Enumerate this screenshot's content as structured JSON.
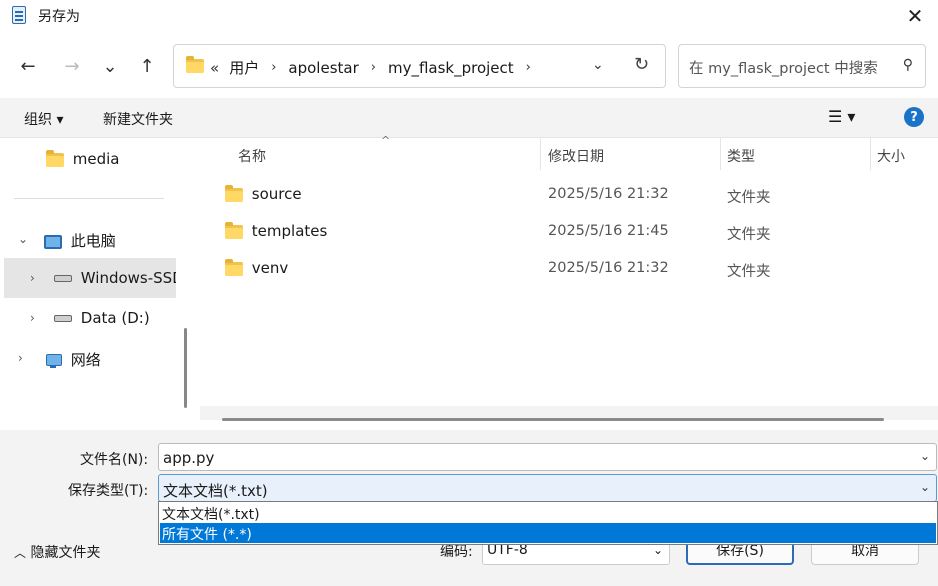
{
  "window": {
    "title": "另存为",
    "close": "✕"
  },
  "nav": {
    "back": "←",
    "forward": "→",
    "recent": "⌄",
    "up": "↑",
    "path": [
      "用户",
      "apolestar",
      "my_flask_project"
    ],
    "overflow": "«",
    "search_placeholder": "在 my_flask_project 中搜索"
  },
  "toolbar": {
    "organize": "组织 ▾",
    "new_folder": "新建文件夹",
    "view": "☰ ▾",
    "help": "?"
  },
  "sidebar": {
    "items": [
      {
        "label": "media"
      },
      {
        "label": "此电脑"
      },
      {
        "label": "Windows-SSD"
      },
      {
        "label": "Data (D:)"
      },
      {
        "label": "网络"
      }
    ]
  },
  "files": {
    "columns": [
      "名称",
      "修改日期",
      "类型",
      "大小"
    ],
    "rows": [
      {
        "name": "source",
        "date": "2025/5/16 21:32",
        "type": "文件夹"
      },
      {
        "name": "templates",
        "date": "2025/5/16 21:45",
        "type": "文件夹"
      },
      {
        "name": "venv",
        "date": "2025/5/16 21:32",
        "type": "文件夹"
      }
    ]
  },
  "save": {
    "filename_label": "文件名(N):",
    "filename_value": "app.py",
    "filetype_label": "保存类型(T):",
    "filetype_value": "文本文档(*.txt)",
    "filetype_options": [
      "文本文档(*.txt)",
      "所有文件  (*.*)"
    ],
    "selected_option": 1,
    "encoding_label": "编码:",
    "encoding_value": "UTF-8",
    "save_button": "保存(S)",
    "cancel_button": "取消",
    "hide_folders": "隐藏文件夹"
  },
  "colors": {
    "accent": "#0078d7",
    "folder": "#ffd866",
    "help": "#1a73c8"
  }
}
